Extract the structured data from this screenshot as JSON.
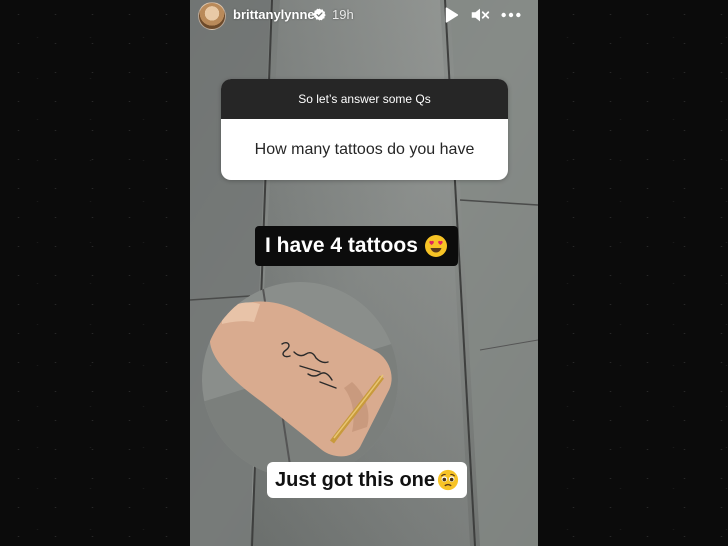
{
  "header": {
    "username": "brittanylynne",
    "timestamp": "19h",
    "icons": [
      "verified-badge-icon",
      "play-icon",
      "mute-icon",
      "more-options-icon"
    ]
  },
  "question_sticker": {
    "prompt": "So let’s answer some Qs",
    "question": "How many tattoos do you have"
  },
  "captions": {
    "answer_text": "I have 4 tattoos",
    "answer_emoji": "smiling-face-with-heart-eyes",
    "photo_caption_text": "Just got this one",
    "photo_caption_emoji": "pleading-face"
  },
  "colors": {
    "caption_black_bg": "#0c0c0c",
    "sticker_header_bg": "#262626",
    "emoji_yellow": "#f7c325"
  }
}
